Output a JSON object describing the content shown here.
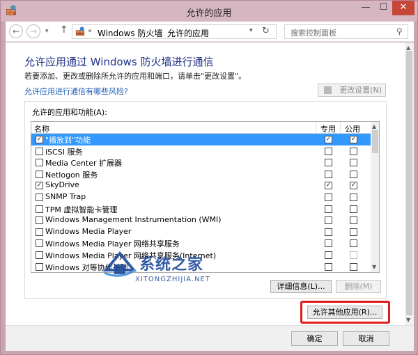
{
  "window": {
    "title": "允许的应用",
    "controls": {
      "minimize": "—",
      "maximize": "☐",
      "close": "✕"
    }
  },
  "navbar": {
    "back_icon": "←",
    "forward_icon": "→",
    "recent_icon": "▾",
    "up_icon": "↑",
    "address_chevron": "«",
    "crumbs": [
      "Windows 防火墙",
      "允许的应用"
    ],
    "crumb_sep": "›",
    "dropdown_icon": "▾",
    "refresh_icon": "↻",
    "search_placeholder": "搜索控制面板",
    "search_icon": "⚲"
  },
  "main": {
    "heading": "允许应用通过 Windows 防火墙进行通信",
    "description": "若要添加、更改或删除所允许的应用和端口，请单击\"更改设置\"。",
    "risk_link": "允许应用进行通信有哪些风险?",
    "change_settings_label": "更改设置(N)",
    "group_label": "允许的应用和功能(A):",
    "columns": {
      "name": "名称",
      "private": "专用",
      "public": "公用"
    },
    "rows": [
      {
        "name": "\"播放到\"功能",
        "enabled": true,
        "private": true,
        "public": true,
        "selected": true
      },
      {
        "name": "iSCSI 服务",
        "enabled": false,
        "private": false,
        "public": false
      },
      {
        "name": "Media Center 扩展器",
        "enabled": false,
        "private": false,
        "public": false
      },
      {
        "name": "Netlogon 服务",
        "enabled": false,
        "private": false,
        "public": false
      },
      {
        "name": "SkyDrive",
        "enabled": true,
        "private": true,
        "public": true
      },
      {
        "name": "SNMP Trap",
        "enabled": false,
        "private": false,
        "public": false
      },
      {
        "name": "TPM 虚拟智能卡管理",
        "enabled": false,
        "private": false,
        "public": false
      },
      {
        "name": "Windows Management Instrumentation (WMI)",
        "enabled": false,
        "private": false,
        "public": false
      },
      {
        "name": "Windows Media Player",
        "enabled": false,
        "private": false,
        "public": false
      },
      {
        "name": "Windows Media Player 网络共享服务",
        "enabled": false,
        "private": false,
        "public": false
      },
      {
        "name": "Windows Media Player 网络共享服务(Internet)",
        "enabled": false,
        "private": false,
        "public": false,
        "public_dim": true
      },
      {
        "name": "Windows 对等协作基础",
        "enabled": false,
        "private": false,
        "public": false
      }
    ],
    "details_label": "详细信息(L)...",
    "delete_label": "删除(M)",
    "allow_other_label": "允许其他应用(R)..."
  },
  "footer": {
    "ok_label": "确定",
    "cancel_label": "取消"
  },
  "watermark": {
    "title": "系统之家",
    "subtitle": "XITONGZHIJIA.NET"
  },
  "scroll_icons": {
    "up": "▲",
    "down": "▼"
  },
  "check_glyph": "✓",
  "colors": {
    "accent_heading": "#1e3287",
    "selected_row": "#3399ff",
    "highlight_box": "#e01b1b",
    "link": "#1c5bb5"
  }
}
